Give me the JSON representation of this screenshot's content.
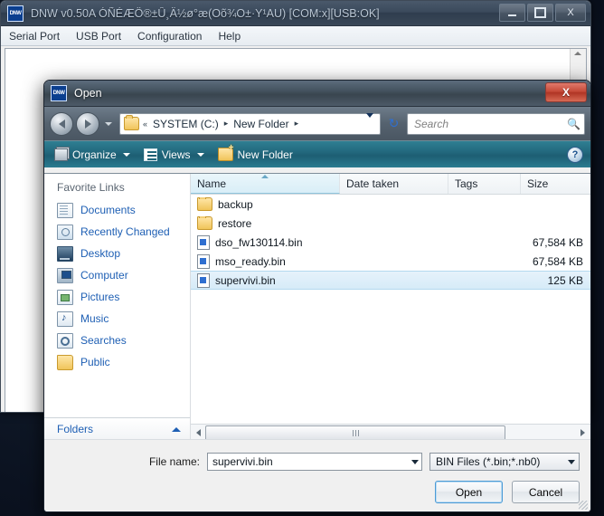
{
  "main_window": {
    "title": "DNW v0.50A ÓÑÉÆÖ®±Û¸Ä½ø°æ(Oõ¾O±·Y¹AU)  [COM:x][USB:OK]",
    "app_icon": "dnw-icon",
    "caption": {
      "minimize": "minimize-icon",
      "maximize": "maximize-icon",
      "close": "X"
    },
    "menu": [
      {
        "label": "Serial Port"
      },
      {
        "label": "USB Port"
      },
      {
        "label": "Configuration"
      },
      {
        "label": "Help"
      }
    ]
  },
  "dialog": {
    "title": "Open",
    "close_label": "X",
    "nav": {
      "back": "back-arrow-icon",
      "forward": "forward-arrow-icon",
      "history_caret": "chevron-down-icon",
      "breadcrumb": {
        "folder_icon": "folder-icon",
        "overflow": "«",
        "parts": [
          "SYSTEM (C:)",
          "New Folder"
        ],
        "separator": "▸"
      },
      "refresh": "↻",
      "search_placeholder": "Search",
      "search_value": "",
      "search_icon": "search-icon"
    },
    "toolbar": {
      "organize": "Organize",
      "views": "Views",
      "new_folder": "New Folder",
      "help": "?"
    },
    "sidebar": {
      "header": "Favorite Links",
      "items": [
        {
          "label": "Documents",
          "icon": "documents-icon"
        },
        {
          "label": "Recently Changed",
          "icon": "recently-changed-icon"
        },
        {
          "label": "Desktop",
          "icon": "desktop-icon"
        },
        {
          "label": "Computer",
          "icon": "computer-icon"
        },
        {
          "label": "Pictures",
          "icon": "pictures-icon"
        },
        {
          "label": "Music",
          "icon": "music-icon"
        },
        {
          "label": "Searches",
          "icon": "searches-icon"
        },
        {
          "label": "Public",
          "icon": "public-folder-icon"
        }
      ],
      "folders_label": "Folders",
      "folders_chevron": "chevron-up-icon"
    },
    "filelist": {
      "columns": [
        {
          "label": "Name",
          "sorted": "ascending"
        },
        {
          "label": "Date taken"
        },
        {
          "label": "Tags"
        },
        {
          "label": "Size"
        }
      ],
      "rows": [
        {
          "name": "backup",
          "date": "",
          "tags": "",
          "size": "",
          "type": "folder",
          "selected": false
        },
        {
          "name": "restore",
          "date": "",
          "tags": "",
          "size": "",
          "type": "folder",
          "selected": false
        },
        {
          "name": "dso_fw130114.bin",
          "date": "",
          "tags": "",
          "size": "67,584 KB",
          "type": "binfile",
          "selected": false
        },
        {
          "name": "mso_ready.bin",
          "date": "",
          "tags": "",
          "size": "67,584 KB",
          "type": "binfile",
          "selected": false
        },
        {
          "name": "supervivi.bin",
          "date": "",
          "tags": "",
          "size": "125 KB",
          "type": "binfile",
          "selected": true
        }
      ]
    },
    "footer": {
      "filename_label": "File name:",
      "filename_value": "supervivi.bin",
      "filetype_value": "BIN Files (*.bin;*.nb0)",
      "open_button": "Open",
      "cancel_button": "Cancel"
    }
  },
  "colors": {
    "desktop": "#0d1623",
    "toolbar_teal": "#23697e",
    "link_blue": "#1e5fb4",
    "selection": "#d6ebf8",
    "close_red": "#c64a38"
  }
}
